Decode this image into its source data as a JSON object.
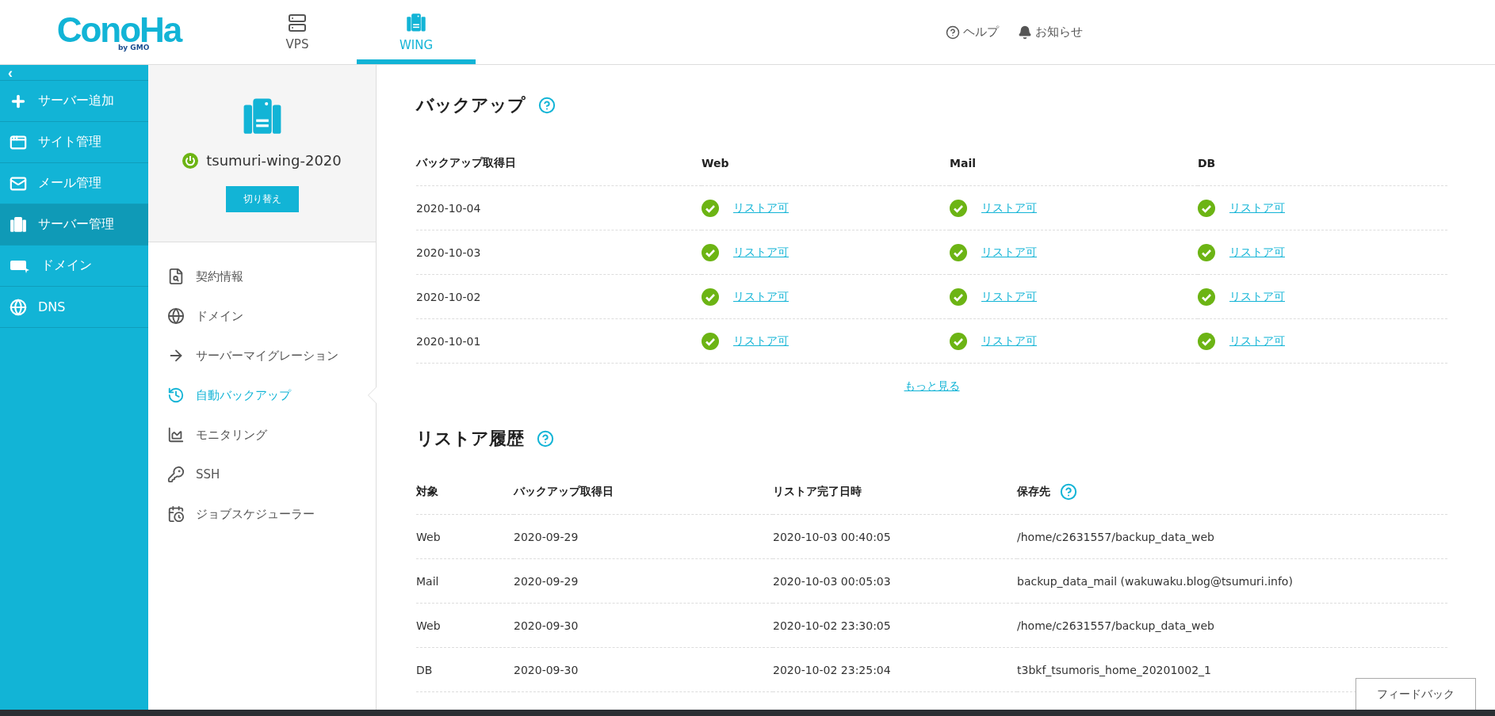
{
  "header": {
    "logo": {
      "name": "ConoHa",
      "sub": "by GMO"
    },
    "tabs": [
      {
        "kind": "vps",
        "label": "VPS",
        "selected": false
      },
      {
        "kind": "wing",
        "label": "WING",
        "selected": true
      }
    ],
    "links": [
      {
        "kind": "help",
        "label": "ヘルプ"
      },
      {
        "kind": "notice",
        "label": "お知らせ"
      }
    ]
  },
  "sidebar": {
    "collapse": "‹",
    "items": [
      {
        "kind": "add",
        "label": "サーバー追加",
        "selected": false
      },
      {
        "kind": "site",
        "label": "サイト管理",
        "selected": false
      },
      {
        "kind": "mail",
        "label": "メール管理",
        "selected": false
      },
      {
        "kind": "server",
        "label": "サーバー管理",
        "selected": true
      },
      {
        "kind": "domain",
        "label": "ドメイン",
        "selected": false
      },
      {
        "kind": "dns",
        "label": "DNS",
        "selected": false
      }
    ]
  },
  "server_panel": {
    "name": "tsumuri-wing-2020",
    "running": true,
    "switch_button": "切り替え",
    "menu": [
      {
        "kind": "contract",
        "label": "契約情報",
        "selected": false
      },
      {
        "kind": "domain",
        "label": "ドメイン",
        "selected": false
      },
      {
        "kind": "migration",
        "label": "サーバーマイグレーション",
        "selected": false
      },
      {
        "kind": "backup",
        "label": "自動バックアップ",
        "selected": true
      },
      {
        "kind": "monitoring",
        "label": "モニタリング",
        "selected": false
      },
      {
        "kind": "ssh",
        "label": "SSH",
        "selected": false
      },
      {
        "kind": "scheduler",
        "label": "ジョブスケジューラー",
        "selected": false
      }
    ]
  },
  "backup": {
    "title": "バックアップ",
    "columns": [
      "バックアップ取得日",
      "Web",
      "Mail",
      "DB"
    ],
    "rows": [
      {
        "date": "2020-10-04",
        "cells": [
          {
            "available": true,
            "label": "リストア可"
          },
          {
            "available": true,
            "label": "リストア可"
          },
          {
            "available": true,
            "label": "リストア可"
          }
        ]
      },
      {
        "date": "2020-10-03",
        "cells": [
          {
            "available": true,
            "label": "リストア可"
          },
          {
            "available": true,
            "label": "リストア可"
          },
          {
            "available": true,
            "label": "リストア可"
          }
        ]
      },
      {
        "date": "2020-10-02",
        "cells": [
          {
            "available": true,
            "label": "リストア可"
          },
          {
            "available": true,
            "label": "リストア可"
          },
          {
            "available": true,
            "label": "リストア可"
          }
        ]
      },
      {
        "date": "2020-10-01",
        "cells": [
          {
            "available": true,
            "label": "リストア可"
          },
          {
            "available": true,
            "label": "リストア可"
          },
          {
            "available": true,
            "label": "リストア可"
          }
        ]
      }
    ],
    "more": "もっと見る"
  },
  "restore_history": {
    "title": "リストア履歴",
    "columns": [
      {
        "label": "対象",
        "help": false
      },
      {
        "label": "バックアップ取得日",
        "help": false
      },
      {
        "label": "リストア完了日時",
        "help": false
      },
      {
        "label": "保存先",
        "help": true
      }
    ],
    "rows": [
      [
        "Web",
        "2020-09-29",
        "2020-10-03 00:40:05",
        "/home/c2631557/backup_data_web"
      ],
      [
        "Mail",
        "2020-09-29",
        "2020-10-03 00:05:03",
        "backup_data_mail (wakuwaku.blog@tsumuri.info)"
      ],
      [
        "Web",
        "2020-09-30",
        "2020-10-02 23:30:05",
        "/home/c2631557/backup_data_web"
      ],
      [
        "DB",
        "2020-09-30",
        "2020-10-02 23:25:04",
        "t3bkf_tsumoris_home_20201002_1"
      ]
    ]
  },
  "feedback": "フィードバック"
}
